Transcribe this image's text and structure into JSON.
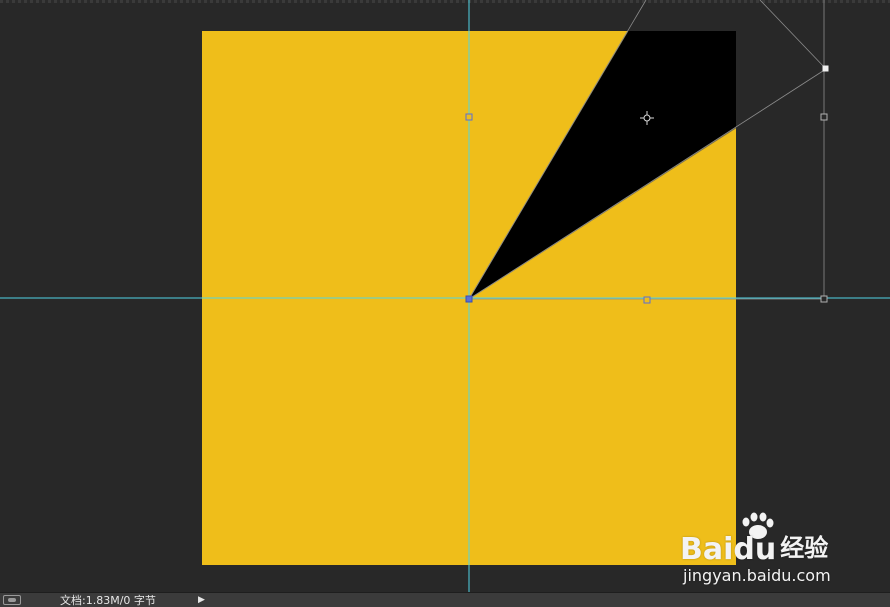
{
  "canvas": {
    "background_color": "#282828",
    "artboard_color": "#efbe1a",
    "triangle_color": "#000000",
    "guide_color": "#4fd5e6",
    "handle_color": "#5a6fd6"
  },
  "statusbar": {
    "doc_info": "文档:1.83M/0 字节",
    "arrow": "▶",
    "icon": "eye-toggle-icon"
  },
  "watermark": {
    "logo_prefix": "Bai",
    "logo_suffix": "du",
    "logo_cn": "经验",
    "url": "jingyan.baidu.com"
  }
}
